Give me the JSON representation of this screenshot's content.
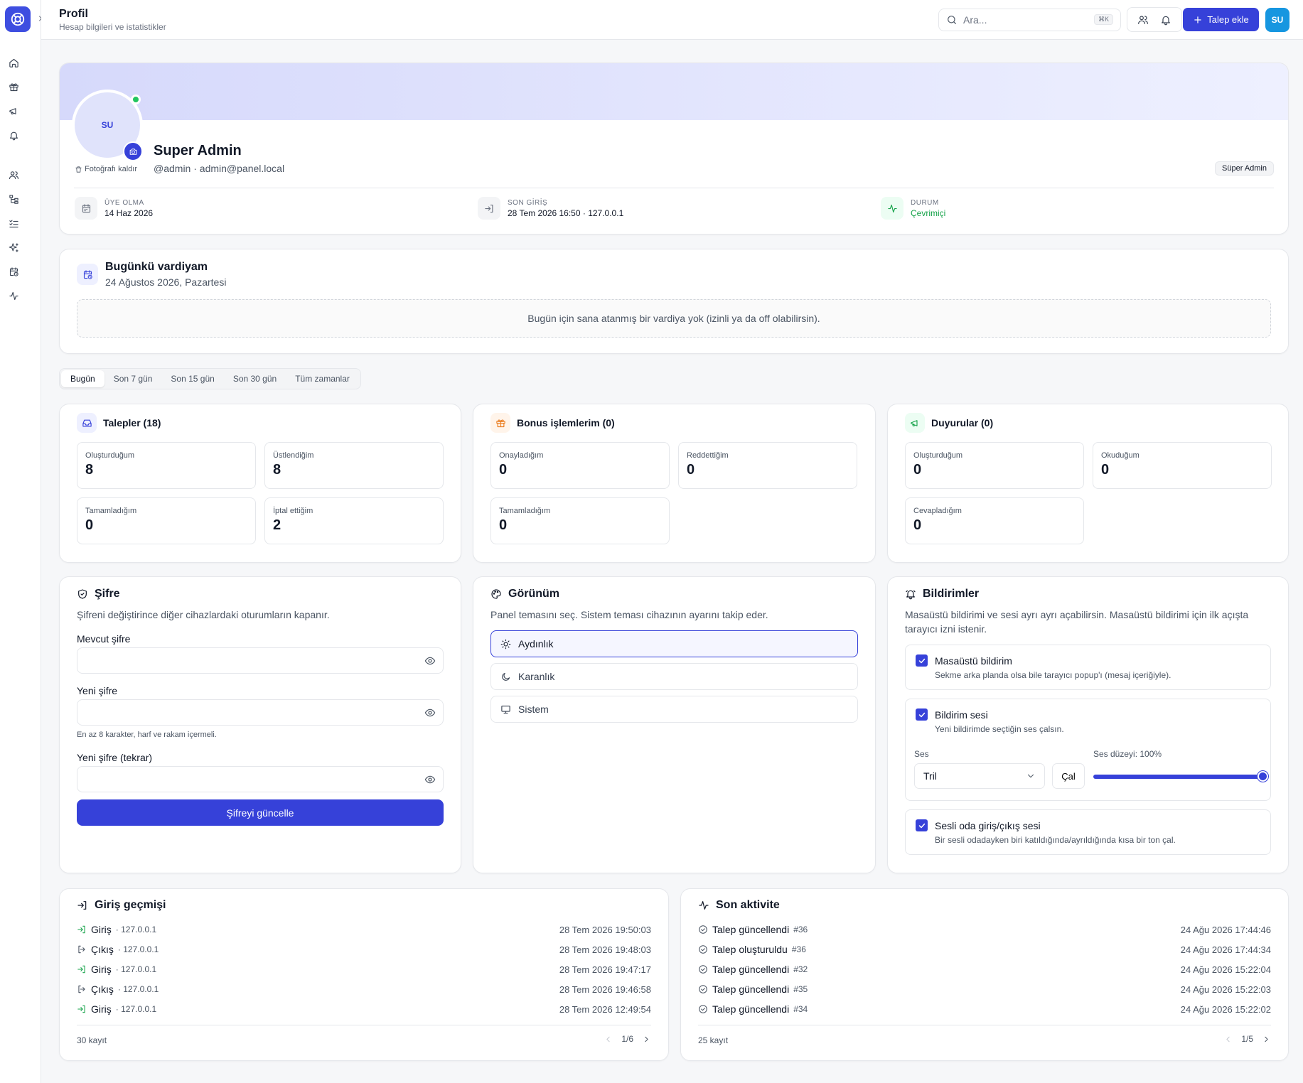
{
  "header": {
    "title": "Profil",
    "subtitle": "Hesap bilgileri ve istatistikler",
    "search_placeholder": "Ara...",
    "search_shortcut": "⌘K",
    "add_request_label": "Talep ekle",
    "user_initials": "SU"
  },
  "sidebar": {
    "icons": [
      "home-icon",
      "gift-icon",
      "megaphone-icon",
      "bell-icon",
      "users-icon",
      "tree-icon",
      "list-checks-icon",
      "sparkles-icon",
      "calendar-clock-icon",
      "activity-icon"
    ]
  },
  "profile": {
    "initials": "SU",
    "remove_photo": "Fotoğrafı kaldır",
    "name": "Super Admin",
    "handle": "@admin · admin@panel.local",
    "role": "Süper Admin",
    "stats": [
      {
        "label": "ÜYE OLMA",
        "value": "14 Haz 2026"
      },
      {
        "label": "SON GİRİŞ",
        "value": "28 Tem 2026 16:50 · 127.0.0.1"
      },
      {
        "label": "DURUM",
        "value": "Çevrimiçi"
      }
    ]
  },
  "shift": {
    "title": "Bugünkü vardiyam",
    "date": "24 Ağustos 2026, Pazartesi",
    "empty": "Bugün için sana atanmış bir vardiya yok (izinli ya da off olabilirsin)."
  },
  "range_tabs": [
    "Bugün",
    "Son 7 gün",
    "Son 15 gün",
    "Son 30 gün",
    "Tüm zamanlar"
  ],
  "stat_cards": [
    {
      "title": "Talepler (18)",
      "items": [
        {
          "label": "Oluşturduğum",
          "value": "8"
        },
        {
          "label": "Üstlendiğim",
          "value": "8"
        },
        {
          "label": "Tamamladığım",
          "value": "0"
        },
        {
          "label": "İptal ettiğim",
          "value": "2"
        }
      ]
    },
    {
      "title": "Bonus işlemlerim (0)",
      "items": [
        {
          "label": "Onayladığım",
          "value": "0"
        },
        {
          "label": "Reddettiğim",
          "value": "0"
        },
        {
          "label": "Tamamladığım",
          "value": "0"
        }
      ]
    },
    {
      "title": "Duyurular (0)",
      "items": [
        {
          "label": "Oluşturduğum",
          "value": "0"
        },
        {
          "label": "Okuduğum",
          "value": "0"
        },
        {
          "label": "Cevapladığım",
          "value": "0"
        }
      ]
    }
  ],
  "password": {
    "title": "Şifre",
    "desc": "Şifreni değiştirince diğer cihazlardaki oturumların kapanır.",
    "current_label": "Mevcut şifre",
    "new_label": "Yeni şifre",
    "hint": "En az 8 karakter, harf ve rakam içermeli.",
    "confirm_label": "Yeni şifre (tekrar)",
    "submit": "Şifreyi güncelle"
  },
  "appearance": {
    "title": "Görünüm",
    "desc": "Panel temasını seç. Sistem teması cihazının ayarını takip eder.",
    "options": [
      "Aydınlık",
      "Karanlık",
      "Sistem"
    ]
  },
  "notifications": {
    "title": "Bildirimler",
    "desc": "Masaüstü bildirimi ve sesi ayrı ayrı açabilirsin. Masaüstü bildirimi için ilk açışta tarayıcı izni istenir.",
    "desktop_title": "Masaüstü bildirim",
    "desktop_desc": "Sekme arka planda olsa bile tarayıcı popup'ı (mesaj içeriğiyle).",
    "sound_title": "Bildirim sesi",
    "sound_desc": "Yeni bildirimde seçtiğin ses çalsın.",
    "sound_label": "Ses",
    "sound_value": "Tril",
    "play": "Çal",
    "volume_label": "Ses düzeyi: 100%",
    "volume": 1.0,
    "voice_title": "Sesli oda giriş/çıkış sesi",
    "voice_desc": "Bir sesli odadayken biri katıldığında/ayrıldığında kısa bir ton çal."
  },
  "login_history": {
    "title": "Giriş geçmişi",
    "rows": [
      {
        "type": "Giriş",
        "ip": "· 127.0.0.1",
        "time": "28 Tem 2026 19:50:03"
      },
      {
        "type": "Çıkış",
        "ip": "· 127.0.0.1",
        "time": "28 Tem 2026 19:48:03"
      },
      {
        "type": "Giriş",
        "ip": "· 127.0.0.1",
        "time": "28 Tem 2026 19:47:17"
      },
      {
        "type": "Çıkış",
        "ip": "· 127.0.0.1",
        "time": "28 Tem 2026 19:46:58"
      },
      {
        "type": "Giriş",
        "ip": "· 127.0.0.1",
        "time": "28 Tem 2026 12:49:54"
      }
    ],
    "count": "30 kayıt",
    "page": "1/6"
  },
  "activity": {
    "title": "Son aktivite",
    "rows": [
      {
        "action": "Talep güncellendi",
        "ref": "#36",
        "time": "24 Ağu 2026 17:44:46"
      },
      {
        "action": "Talep oluşturuldu",
        "ref": "#36",
        "time": "24 Ağu 2026 17:44:34"
      },
      {
        "action": "Talep güncellendi",
        "ref": "#32",
        "time": "24 Ağu 2026 15:22:04"
      },
      {
        "action": "Talep güncellendi",
        "ref": "#35",
        "time": "24 Ağu 2026 15:22:03"
      },
      {
        "action": "Talep güncellendi",
        "ref": "#34",
        "time": "24 Ağu 2026 15:22:02"
      }
    ],
    "count": "25 kayıt",
    "page": "1/5"
  },
  "colors": {
    "primary": "#3641d9",
    "online": "#22c55e",
    "status_green": "#16a34a",
    "avatar_blue": "#1696e0"
  }
}
